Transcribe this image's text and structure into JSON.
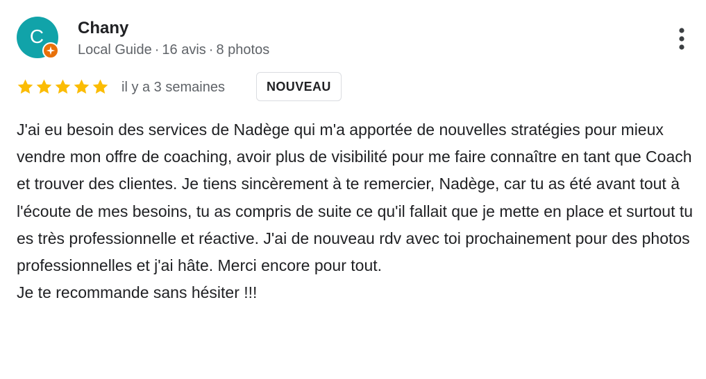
{
  "reviewer": {
    "avatar_letter": "C",
    "avatar_color": "#11a3a9",
    "badge_color": "#e8710a",
    "name": "Chany",
    "meta": [
      "Local Guide",
      "16 avis",
      "8 photos"
    ],
    "meta_separator": "·"
  },
  "review": {
    "rating": 5,
    "rating_max": 5,
    "star_color": "#fbbc04",
    "date": "il y a 3 semaines",
    "badge": "NOUVEAU",
    "paragraphs": [
      "J'ai eu besoin des services de Nadège qui m'a apportée de nouvelles stratégies pour mieux vendre mon offre de coaching, avoir plus de visibilité pour me faire connaître en tant que Coach et trouver des clientes. Je tiens sincèrement à te remercier, Nadège, car tu as été avant tout à l'écoute de mes besoins, tu as compris de suite ce qu'il fallait que je mette en place et surtout tu es très professionnelle et réactive. J'ai de nouveau rdv avec toi prochainement pour des photos professionnelles et j'ai hâte. Merci encore pour tout.",
      "Je te recommande sans hésiter !!!"
    ]
  },
  "icons": {
    "more": "more-vert-icon",
    "star": "star-icon",
    "local_guide": "local-guide-badge-icon"
  }
}
